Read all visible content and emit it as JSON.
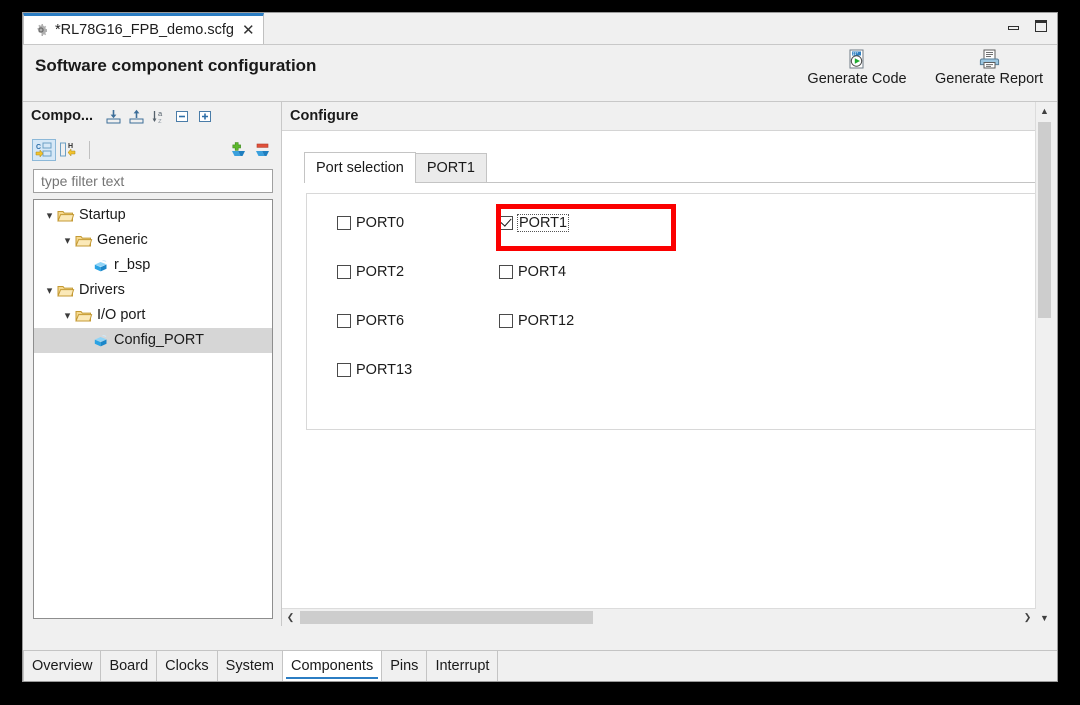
{
  "window": {
    "minimize_tooltip": "Minimize",
    "maximize_tooltip": "Maximize"
  },
  "editor_tab": {
    "icon": "gear-icon",
    "title": "*RL78G16_FPB_demo.scfg",
    "close_glyph": "✕"
  },
  "header": {
    "title": "Software component configuration",
    "actions": [
      {
        "label": "Generate Code",
        "icon": "generate-code-icon"
      },
      {
        "label": "Generate Report",
        "icon": "generate-report-icon"
      }
    ]
  },
  "components_panel": {
    "title": "Compo...",
    "toolbar_icons": [
      "import-icon",
      "export-icon",
      "sort-az-icon",
      "collapse-all-icon",
      "expand-all-icon"
    ],
    "sub_toolbar_icons": [
      "show-components-icon",
      "show-hardware-icon",
      "add-component-icon",
      "remove-component-icon"
    ],
    "filter": {
      "placeholder": "type filter text",
      "value": ""
    },
    "tree": [
      {
        "label": "Startup",
        "icon": "folder-icon",
        "depth": 0,
        "twisty": "▾",
        "selected": false
      },
      {
        "label": "Generic",
        "icon": "folder-icon",
        "depth": 1,
        "twisty": "▾",
        "selected": false
      },
      {
        "label": "r_bsp",
        "icon": "component-icon",
        "depth": 2,
        "twisty": "",
        "selected": false
      },
      {
        "label": "Drivers",
        "icon": "folder-icon",
        "depth": 0,
        "twisty": "▾",
        "selected": false
      },
      {
        "label": "I/O port",
        "icon": "folder-icon",
        "depth": 1,
        "twisty": "▾",
        "selected": false
      },
      {
        "label": "Config_PORT",
        "icon": "component-icon",
        "depth": 2,
        "twisty": "",
        "selected": true
      }
    ]
  },
  "configure_panel": {
    "title": "Configure",
    "tabs": [
      {
        "label": "Port selection",
        "active": true
      },
      {
        "label": "PORT1",
        "active": false
      }
    ],
    "port_checkboxes": [
      {
        "label": "PORT0",
        "checked": false,
        "focused": false
      },
      {
        "label": "PORT1",
        "checked": true,
        "focused": true
      },
      {
        "label": "PORT2",
        "checked": false,
        "focused": false
      },
      {
        "label": "PORT4",
        "checked": false,
        "focused": false
      },
      {
        "label": "PORT6",
        "checked": false,
        "focused": false
      },
      {
        "label": "PORT12",
        "checked": false,
        "focused": false
      },
      {
        "label": "PORT13",
        "checked": false,
        "focused": false
      }
    ],
    "highlight_color": "#fb0000",
    "highlight_target": "PORT1",
    "scroll": {
      "vertical_up_glyph": "▲",
      "vertical_down_glyph": "▼",
      "horizontal_left_glyph": "❮",
      "horizontal_right_glyph": "❯"
    }
  },
  "bottom_tabs": [
    {
      "label": "Overview",
      "active": false
    },
    {
      "label": "Board",
      "active": false
    },
    {
      "label": "Clocks",
      "active": false
    },
    {
      "label": "System",
      "active": false
    },
    {
      "label": "Components",
      "active": true
    },
    {
      "label": "Pins",
      "active": false
    },
    {
      "label": "Interrupt",
      "active": false
    }
  ],
  "colors": {
    "accent": "#2b7dc3",
    "annotation": "#fb0000",
    "selection": "#d6d6d6"
  }
}
